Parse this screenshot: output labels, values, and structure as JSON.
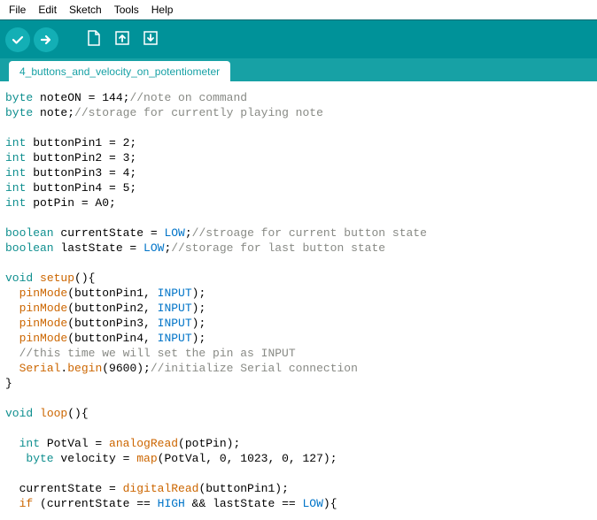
{
  "menubar": {
    "file": "File",
    "edit": "Edit",
    "sketch": "Sketch",
    "tools": "Tools",
    "help": "Help"
  },
  "tab": {
    "name": "4_buttons_and_velocity_on_potentiometer"
  },
  "code": {
    "l1_a": "byte",
    "l1_b": " noteON = 144;",
    "l1_c": "//note on command",
    "l2_a": "byte",
    "l2_b": " note;",
    "l2_c": "//storage for currently playing note",
    "l3_a": "int",
    "l3_b": " buttonPin1 = 2;",
    "l4_a": "int",
    "l4_b": " buttonPin2 = 3;",
    "l5_a": "int",
    "l5_b": " buttonPin3 = 4;",
    "l6_a": "int",
    "l6_b": " buttonPin4 = 5;",
    "l7_a": "int",
    "l7_b": " potPin = A0;",
    "l8_a": "boolean",
    "l8_b": " currentState = ",
    "l8_c": "LOW",
    "l8_d": ";",
    "l8_e": "//stroage for current button state",
    "l9_a": "boolean",
    "l9_b": " lastState = ",
    "l9_c": "LOW",
    "l9_d": ";",
    "l9_e": "//storage for last button state",
    "l10_a": "void",
    "l10_b": " ",
    "l10_c": "setup",
    "l10_d": "(){",
    "l11_a": "  ",
    "l11_b": "pinMode",
    "l11_c": "(buttonPin1, ",
    "l11_d": "INPUT",
    "l11_e": ");",
    "l12_a": "  ",
    "l12_b": "pinMode",
    "l12_c": "(buttonPin2, ",
    "l12_d": "INPUT",
    "l12_e": ");",
    "l13_a": "  ",
    "l13_b": "pinMode",
    "l13_c": "(buttonPin3, ",
    "l13_d": "INPUT",
    "l13_e": ");",
    "l14_a": "  ",
    "l14_b": "pinMode",
    "l14_c": "(buttonPin4, ",
    "l14_d": "INPUT",
    "l14_e": ");",
    "l15": "  //this time we will set the pin as INPUT",
    "l16_a": "  ",
    "l16_b": "Serial",
    "l16_c": ".",
    "l16_d": "begin",
    "l16_e": "(9600);",
    "l16_f": "//initialize Serial connection",
    "l17": "}",
    "l18_a": "void",
    "l18_b": " ",
    "l18_c": "loop",
    "l18_d": "(){",
    "l19_a": "  ",
    "l19_b": "int",
    "l19_c": " PotVal = ",
    "l19_d": "analogRead",
    "l19_e": "(potPin);",
    "l20_a": "   ",
    "l20_b": "byte",
    "l20_c": " velocity = ",
    "l20_d": "map",
    "l20_e": "(PotVal, 0, 1023, 0, 127);",
    "l21_a": "  currentState = ",
    "l21_b": "digitalRead",
    "l21_c": "(buttonPin1);",
    "l22_a": "  ",
    "l22_b": "if",
    "l22_c": " (currentState == ",
    "l22_d": "HIGH",
    "l22_e": " && lastState == ",
    "l22_f": "LOW",
    "l22_g": "){"
  }
}
